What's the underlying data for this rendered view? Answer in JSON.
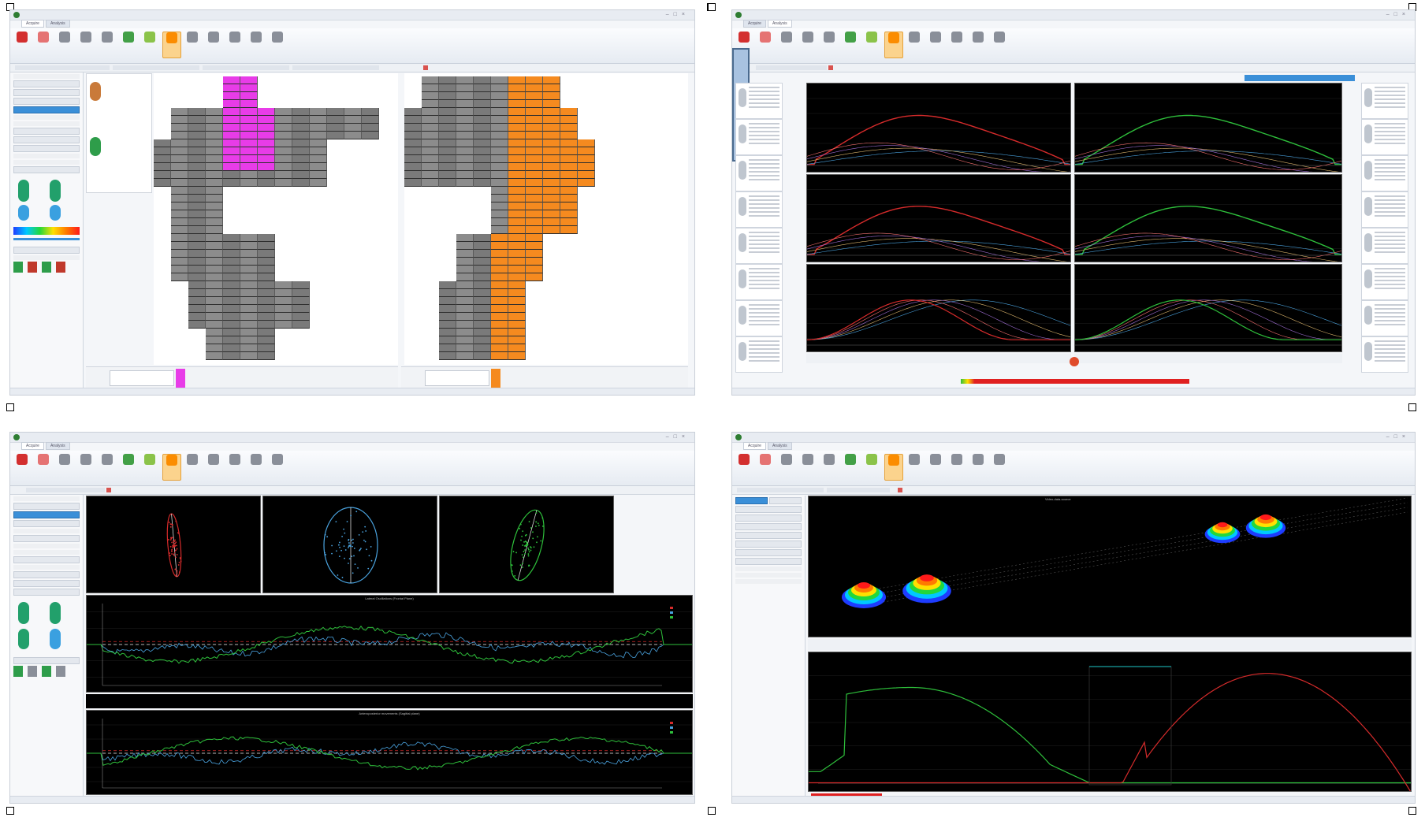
{
  "app": {
    "tabs": [
      "Acquire",
      "Analysis"
    ],
    "ribbon_buttons": [
      {
        "icon": "stop-record-icon",
        "color": "#d32f2f"
      },
      {
        "icon": "grid-icon",
        "color": "#e57373"
      },
      {
        "icon": "footprint-icon",
        "color": "#8a8f99"
      },
      {
        "icon": "balance-icon",
        "color": "#8a8f99"
      },
      {
        "icon": "walk-icon",
        "color": "#8a8f99"
      },
      {
        "icon": "compare-icon",
        "color": "#43a047"
      },
      {
        "icon": "sway-icon",
        "color": "#8bc34a"
      },
      {
        "icon": "gait-icon",
        "color": "#fb8c00"
      },
      {
        "icon": "report-icon",
        "color": "#8a8f99"
      },
      {
        "icon": "print-icon",
        "color": "#8a8f99"
      },
      {
        "icon": "export-icon",
        "color": "#8a8f99"
      },
      {
        "icon": "settings-icon",
        "color": "#8a8f99"
      },
      {
        "icon": "help-icon",
        "color": "#8a8f99"
      }
    ]
  },
  "quad_a": {
    "view": "pressure-zone-editor",
    "left_zone_color": "#e83ce8",
    "right_zone_color": "#f58a1f",
    "sensor_color": "#808080",
    "grid_line_color": "#2e2e2e"
  },
  "quad_b": {
    "view": "force-curves",
    "left_curve_color": "#d62b2b",
    "right_curve_color": "#2ebf3b",
    "secondary_colors": [
      "#4aa3df",
      "#d9b36a",
      "#9c6bd1",
      "#ef6c6c"
    ]
  },
  "quad_c": {
    "view": "stabilometry",
    "chart_titles": [
      "Lateral Oscillations (Frontal Plane)",
      "Anteroposterior movements (Sagittal plane)"
    ],
    "series_colors": {
      "left": "#d62b2b",
      "center": "#4aa3df",
      "right": "#2ebf3b"
    },
    "ellipse_colors": [
      "#d62b2b",
      "#4aa3df",
      "#2ebf3b"
    ]
  },
  "quad_d": {
    "view": "gait-3d",
    "top_title": "Video-data-source",
    "curve_colors": {
      "left": "#2ebf3b",
      "right": "#d62b2b"
    },
    "heat_colors": [
      "#1e3cff",
      "#00c8ff",
      "#22d83a",
      "#ffe000",
      "#ff7a00",
      "#ff1a1a"
    ]
  },
  "corner_markers": [
    {
      "name": "tl"
    },
    {
      "name": "tr"
    },
    {
      "name": "bl"
    },
    {
      "name": "br"
    }
  ]
}
